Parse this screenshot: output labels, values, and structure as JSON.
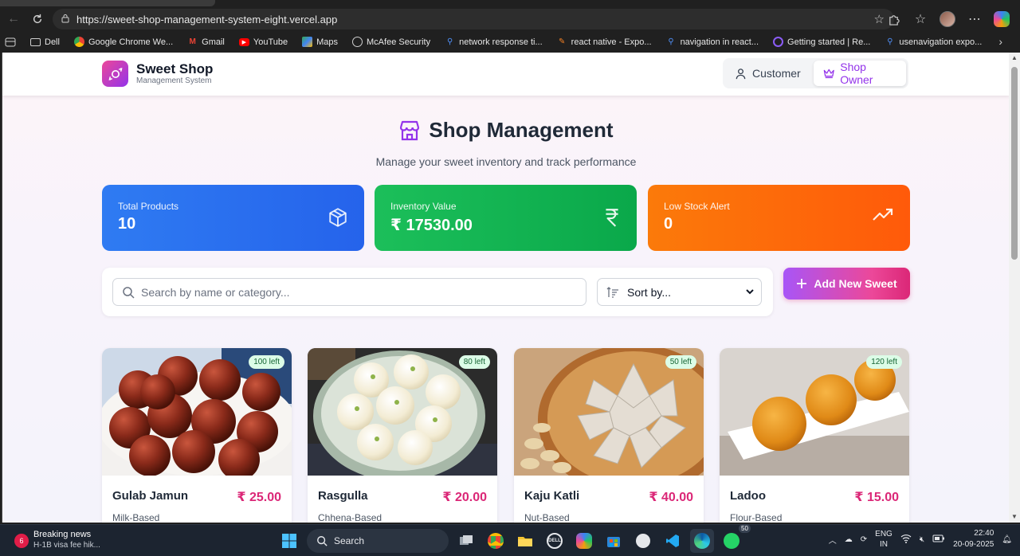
{
  "browser": {
    "url": "https://sweet-shop-management-system-eight.vercel.app",
    "bookmarks": [
      "Dell",
      "Google Chrome We...",
      "Gmail",
      "YouTube",
      "Maps",
      "McAfee Security",
      "network response ti...",
      "react native - Expo...",
      "navigation in react...",
      "Getting started | Re...",
      "usenavigation expo..."
    ]
  },
  "app": {
    "brand_title": "Sweet Shop",
    "brand_subtitle": "Management System",
    "role_customer": "Customer",
    "role_owner": "Shop Owner",
    "active_role": "Shop Owner"
  },
  "page": {
    "title": "Shop Management",
    "subtitle": "Manage your sweet inventory and track performance"
  },
  "stats": [
    {
      "label": "Total Products",
      "value": "10",
      "color": "#2563eb",
      "icon": "box-icon"
    },
    {
      "label": "Inventory Value",
      "value": "₹ 17530.00",
      "color": "#0aa84a",
      "icon": "rupee-icon"
    },
    {
      "label": "Low Stock Alert",
      "value": "0",
      "color": "#ff5a0a",
      "icon": "trending-up-icon"
    }
  ],
  "filters": {
    "search_placeholder": "Search by name or category...",
    "sort_value": "Sort by...",
    "add_button": "Add New Sweet"
  },
  "products": [
    {
      "name": "Gulab Jamun",
      "price": "₹ 25.00",
      "category": "Milk-Based",
      "stock": "100 left"
    },
    {
      "name": "Rasgulla",
      "price": "₹ 20.00",
      "category": "Chhena-Based",
      "stock": "80 left"
    },
    {
      "name": "Kaju Katli",
      "price": "₹ 40.00",
      "category": "Nut-Based",
      "stock": "50 left"
    },
    {
      "name": "Ladoo",
      "price": "₹ 15.00",
      "category": "Flour-Based",
      "stock": "120 left"
    }
  ],
  "taskbar": {
    "news_title": "Breaking news",
    "news_sub": "H-1B visa fee hik...",
    "news_count": "6",
    "search_label": "Search",
    "whatsapp_count": "50",
    "lang1": "ENG",
    "lang2": "IN",
    "time": "22:40",
    "date": "20-09-2025"
  },
  "colors": {
    "accent": "#9333ea",
    "price": "#db2777",
    "badge_bg": "#dcfce7"
  }
}
